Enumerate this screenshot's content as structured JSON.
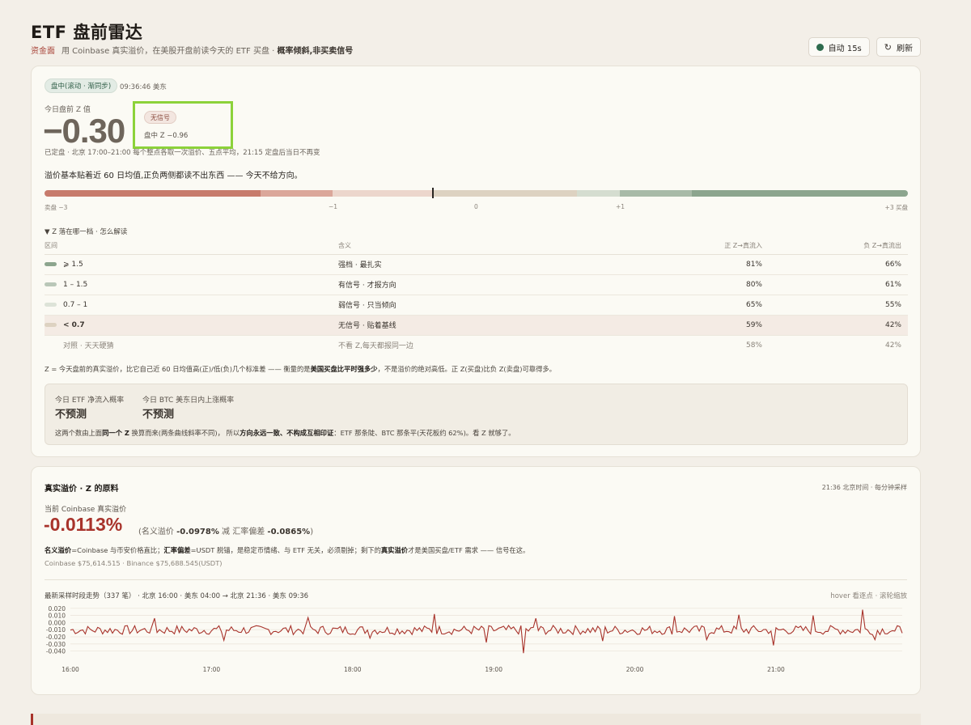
{
  "header": {
    "title": "ETF 盘前雷达",
    "tag": "资金面",
    "subtitle": "用 Coinbase 真实溢价，在美股开盘前读今天的 ETF 买盘 ·",
    "subtitle_bold": "概率倾斜,非买卖信号",
    "auto_label": "自动 15s",
    "refresh_label": "刷新"
  },
  "zcard": {
    "status": "盘中(滚动 · 渐同步)",
    "time": "09:36:46 美东",
    "z_label": "今日盘前 Z 值",
    "z_value": "−0.30",
    "signal_pill": "无信号",
    "intraday_z": "盘中 Z −0.96",
    "lock_note": "已定盘 · 北京 17:00–21:00 每个整点各取一次溢价、五点平均，21:15 定盘后当日不再变",
    "summary": "溢价基本贴着近 60 日均值,正负两侧都读不出东西 —— 今天不给方向。",
    "gauge_ticks": [
      "卖盘 −3",
      "−1",
      "0",
      "+1",
      "+3 买盘"
    ],
    "expander": "▼  Z 落在哪一档 · 怎么解读",
    "table_headers": [
      "区间",
      "含义",
      "正 Z→真流入",
      "负 Z→真流出"
    ],
    "rows": [
      {
        "range": "⩾ 1.5",
        "meaning": "强档 · 最扎实",
        "pos": "81%",
        "neg": "66%"
      },
      {
        "range": "1 – 1.5",
        "meaning": "有信号 · 才报方向",
        "pos": "80%",
        "neg": "61%"
      },
      {
        "range": "0.7 – 1",
        "meaning": "弱信号 · 只当倾向",
        "pos": "65%",
        "neg": "55%"
      },
      {
        "range": "< 0.7",
        "meaning": "无信号 · 贴着基线",
        "pos": "59%",
        "neg": "42%"
      },
      {
        "range": "对照 · 天天硬猜",
        "meaning": "不看 Z,每天都报同一边",
        "pos": "58%",
        "neg": "42%"
      }
    ],
    "zdef_a": "Z = 今天盘前的真实溢价，比它自己近 60 日均值高(正)/低(负)几个标准差 —— 衡量的是",
    "zdef_b": "美国买盘比平时强多少",
    "zdef_c": "，不是溢价的绝对高低。正 Z(买盘)比负 Z(卖盘)可靠得多。",
    "prob_etf_label": "今日 ETF 净流入概率",
    "prob_etf_value": "不预测",
    "prob_btc_label": "今日 BTC 美东日内上涨概率",
    "prob_btc_value": "不预测",
    "pb_a": "这两个数由上面",
    "pb_b": "同一个 Z",
    "pb_c": " 换算而来(两条曲线斜率不同)， 所以",
    "pb_d": "方向永远一致、不构成互相印证",
    "pb_e": "：ETF 那条陡、BTC 那条平(天花板约 62%)。看 Z 就够了。"
  },
  "premium": {
    "title": "真实溢价 · Z 的原料",
    "meta": "21:36 北京时间 · 每分钟采样",
    "label": "当前 Coinbase 真实溢价",
    "value": "-0.0113%",
    "detail_a": "(名义溢价",
    "nominal": "-0.0978%",
    "detail_b": "减 汇率偏差",
    "fx": "-0.0865%",
    "detail_c": ")",
    "def_a": "名义溢价",
    "def_b": "=Coinbase 与币安价格直比；",
    "def_c": "汇率偏差",
    "def_d": "=USDT 脱锚，是稳定币情绪、与 ETF 无关，必须剔掉；剩下的",
    "def_e": "真实溢价",
    "def_f": "才是美国买盘/ETF 需求 —— 信号在这。",
    "prices": "Coinbase $75,614.515 · Binance $75,688.545(USDT)",
    "chart_caption": "最新采样时段走势（337 笔） · 北京 16:00 · 美东 04:00 → 北京 21:36 · 美东 09:36",
    "chart_hint": "hover 看逐点 · 滚轮缩放"
  },
  "chart_data": {
    "type": "line",
    "n_points": 337,
    "x_ticks": [
      "16:00",
      "17:00",
      "18:00",
      "19:00",
      "20:00",
      "21:00"
    ],
    "y_ticks": [
      "0.020",
      "0.010",
      "0.000",
      "-0.010",
      "-0.020",
      "-0.030",
      "-0.040"
    ],
    "ylim": [
      -0.045,
      0.022
    ],
    "baseline": -0.0105,
    "spikes": [
      {
        "i": 34,
        "v": 0.006
      },
      {
        "i": 62,
        "v": -0.025
      },
      {
        "i": 96,
        "v": 0.007
      },
      {
        "i": 121,
        "v": -0.022
      },
      {
        "i": 147,
        "v": 0.012
      },
      {
        "i": 168,
        "v": -0.028
      },
      {
        "i": 188,
        "v": 0.006
      },
      {
        "i": 183,
        "v": -0.043
      },
      {
        "i": 215,
        "v": -0.026
      },
      {
        "i": 244,
        "v": 0.009
      },
      {
        "i": 257,
        "v": -0.024
      },
      {
        "i": 270,
        "v": 0.011
      },
      {
        "i": 284,
        "v": -0.032
      },
      {
        "i": 300,
        "v": 0.01
      },
      {
        "i": 320,
        "v": 0.018
      },
      {
        "i": 325,
        "v": -0.024
      },
      {
        "i": 333,
        "v": -0.012
      }
    ],
    "line_color": "#a8332b"
  }
}
